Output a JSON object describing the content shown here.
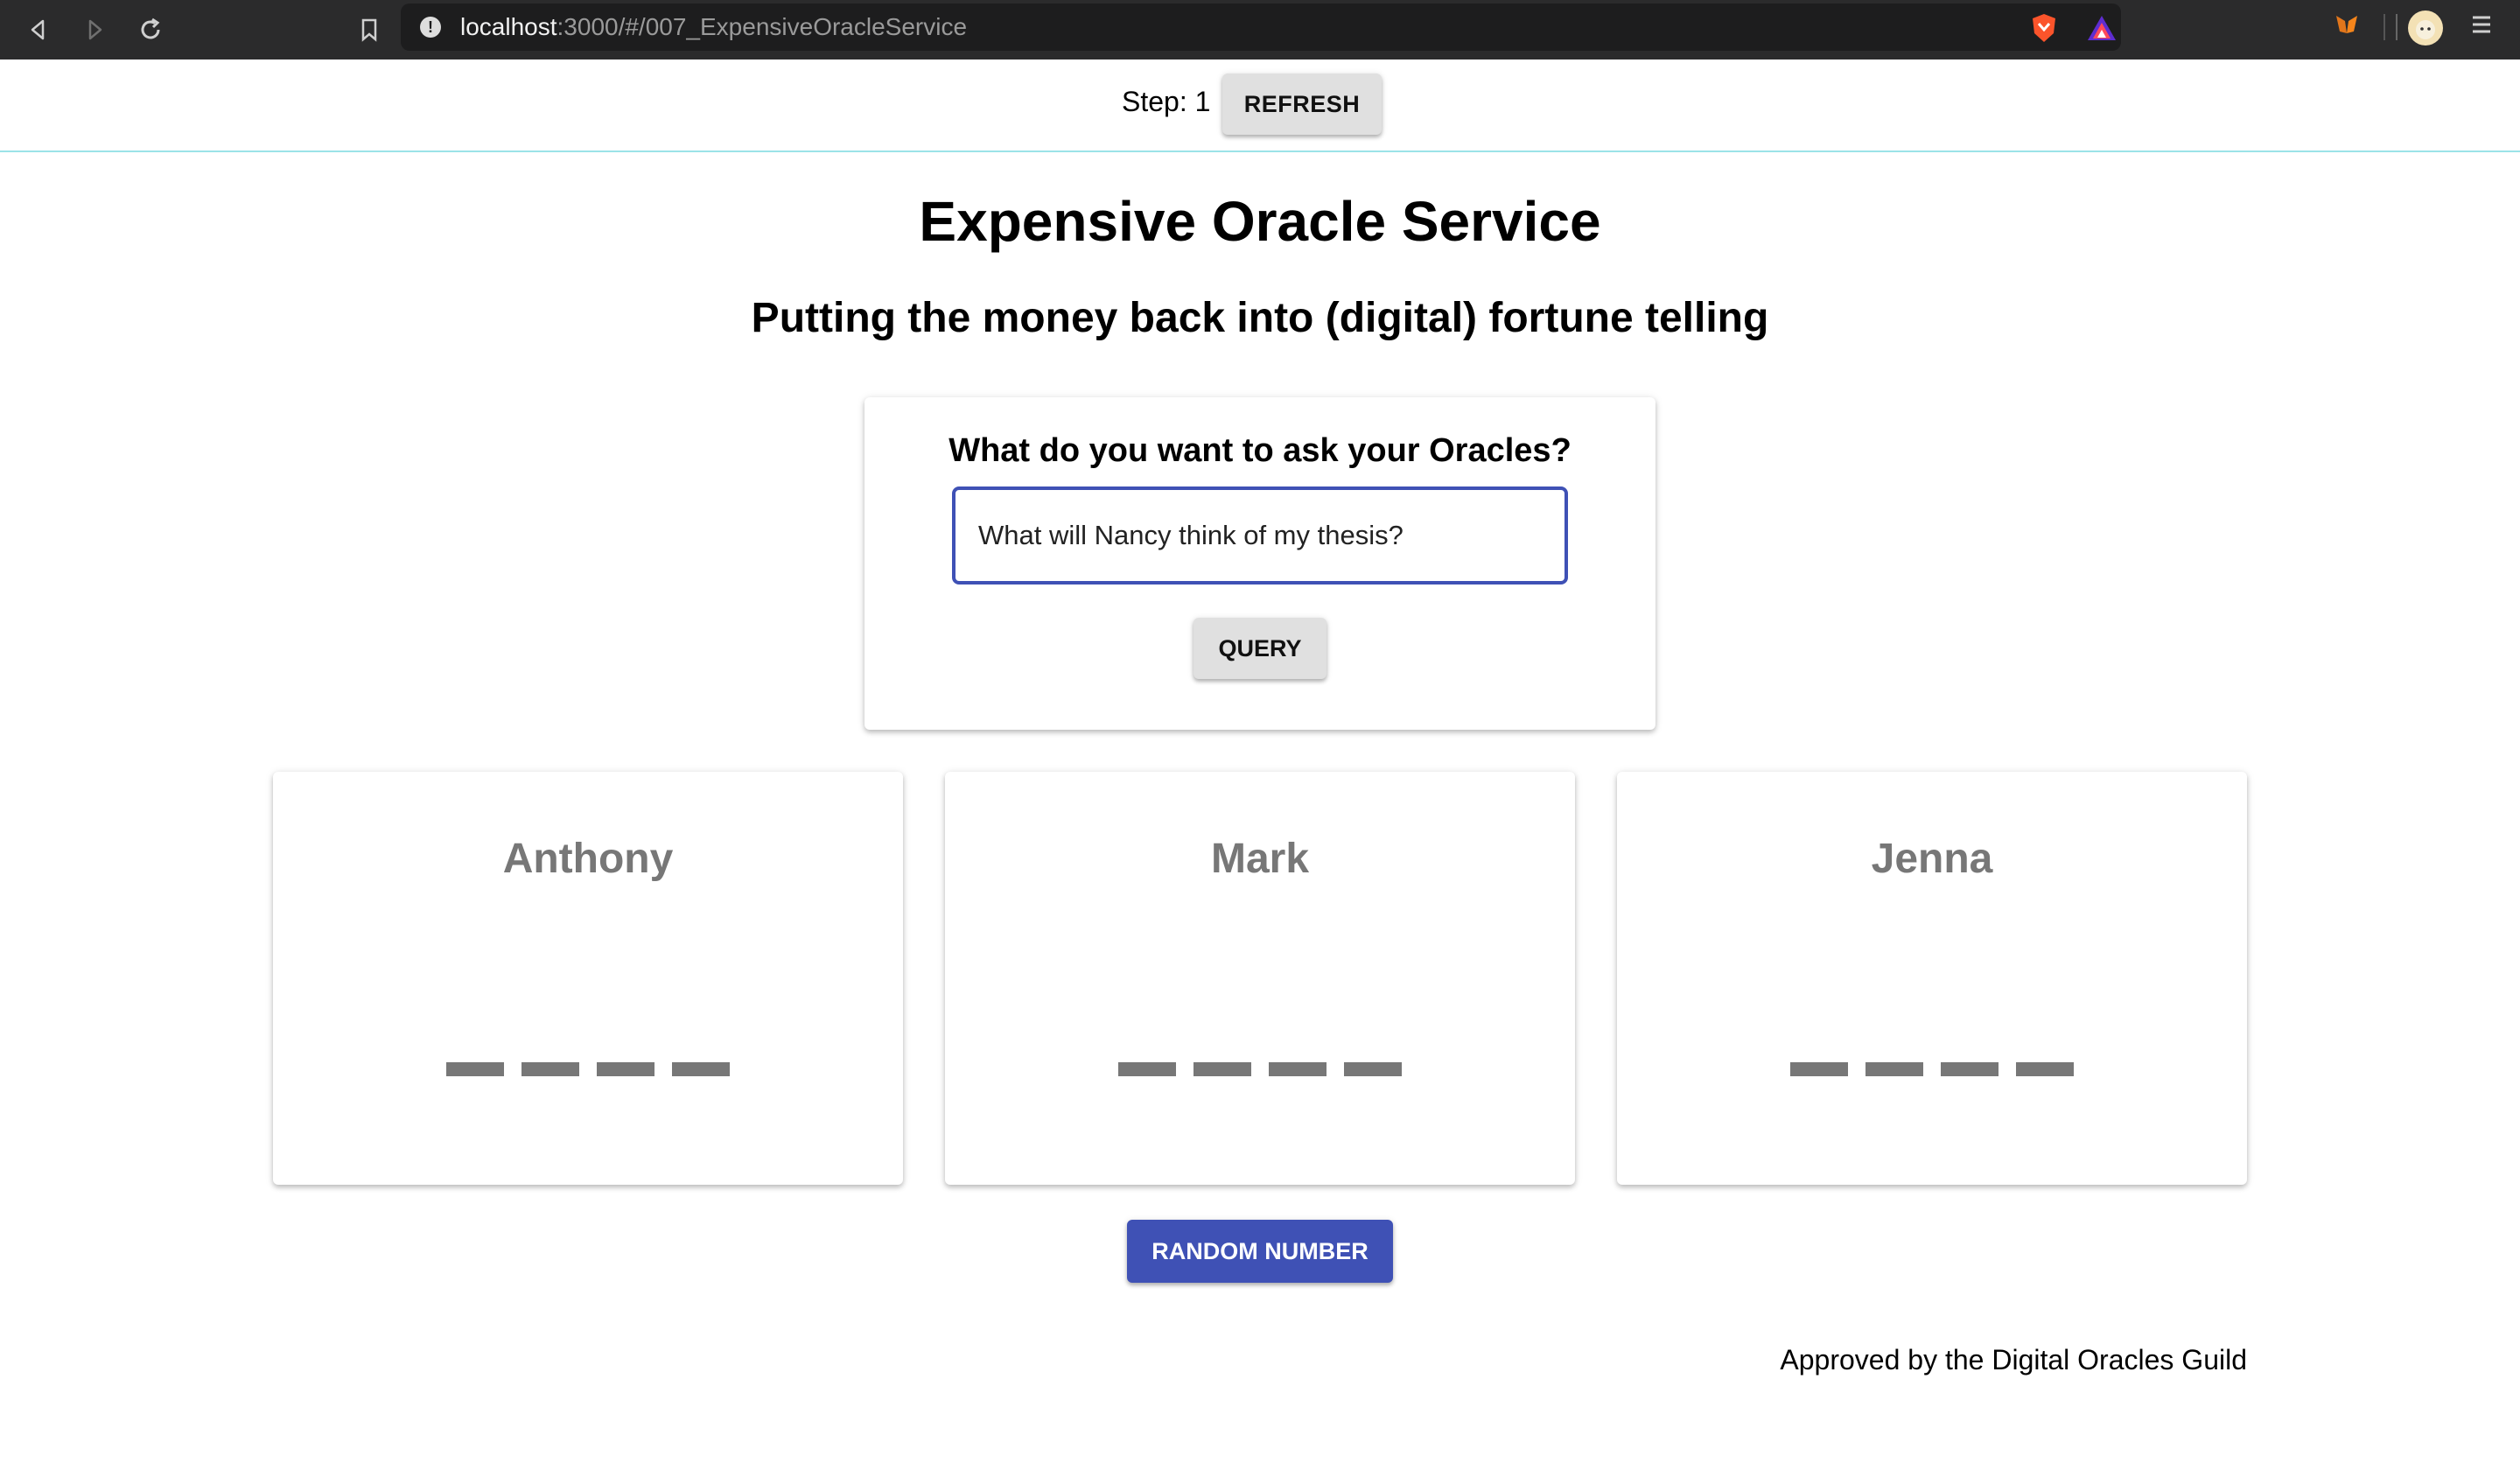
{
  "browser": {
    "url_host": "localhost",
    "url_path": ":3000/#/007_ExpensiveOracleService",
    "icons": [
      "back-icon",
      "forward-icon",
      "reload-icon",
      "bookmark-icon",
      "site-info-icon",
      "brave-shield-icon",
      "brave-rewards-icon",
      "metamask-icon",
      "profile-avatar-icon",
      "menu-icon"
    ]
  },
  "header": {
    "step_label": "Step: 1",
    "refresh_label": "REFRESH"
  },
  "main": {
    "title": "Expensive Oracle Service",
    "subtitle": "Putting the money back into (digital) fortune telling",
    "query": {
      "label": "What do you want to ask your Oracles?",
      "value": "What will Nancy think of my thesis?",
      "button_label": "QUERY"
    },
    "oracles": [
      {
        "name": "Anthony"
      },
      {
        "name": "Mark"
      },
      {
        "name": "Jenna"
      }
    ],
    "random_button_label": "RANDOM NUMBER",
    "footer": "Approved by the Digital Oracles Guild"
  },
  "colors": {
    "primary": "#3f51b5",
    "header_border": "#9be3e8",
    "oracle_text": "#777777"
  }
}
